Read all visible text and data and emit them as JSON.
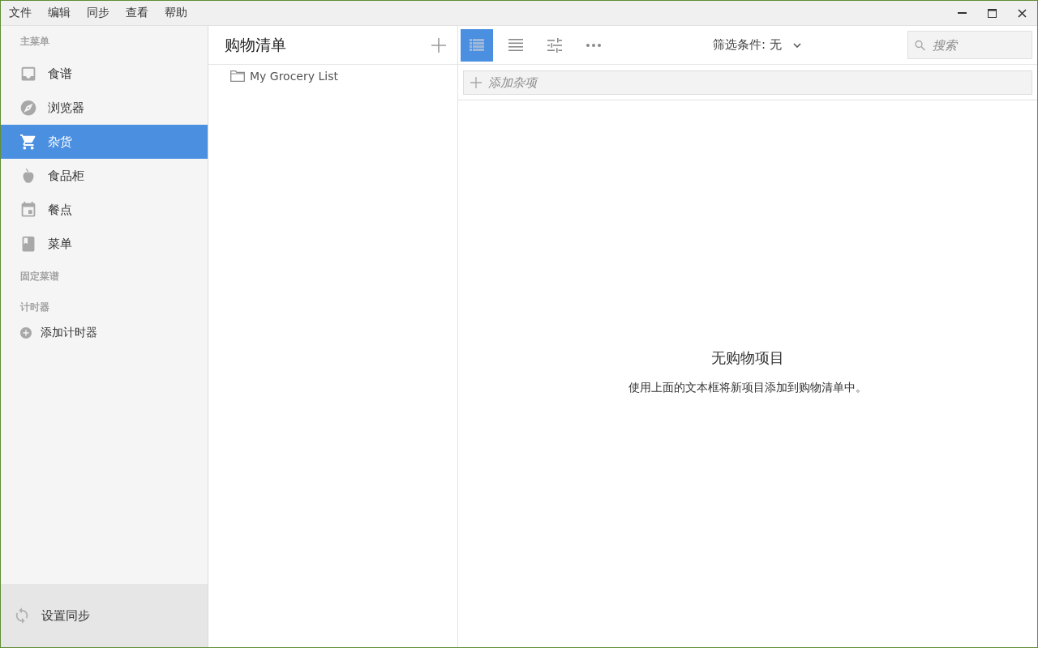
{
  "menu_bar": {
    "items": [
      "文件",
      "编辑",
      "同步",
      "查看",
      "帮助"
    ]
  },
  "sidebar": {
    "main_heading": "主菜单",
    "nav": [
      {
        "label": "食谱",
        "selected": false
      },
      {
        "label": "浏览器",
        "selected": false
      },
      {
        "label": "杂货",
        "selected": true
      },
      {
        "label": "食品柜",
        "selected": false
      },
      {
        "label": "餐点",
        "selected": false
      },
      {
        "label": "菜单",
        "selected": false
      }
    ],
    "pinned_heading": "固定菜谱",
    "timers_heading": "计时器",
    "add_timer": "添加计时器",
    "footer": {
      "label": "设置同步"
    }
  },
  "lists_panel": {
    "title": "购物清单",
    "lists": [
      {
        "label": "My Grocery List",
        "selected": false
      }
    ]
  },
  "toolbar": {
    "view_buttons": [
      {
        "selected": true
      },
      {
        "selected": false
      },
      {
        "selected": false
      },
      {
        "selected": false
      }
    ],
    "filter": {
      "label": "筛选条件: 无"
    },
    "search": {
      "placeholder": "搜索"
    }
  },
  "add_item": {
    "placeholder": "添加杂项"
  },
  "empty_state": {
    "title": "无购物项目",
    "message": "使用上面的文本框将新项目添加到购物清单中。"
  }
}
